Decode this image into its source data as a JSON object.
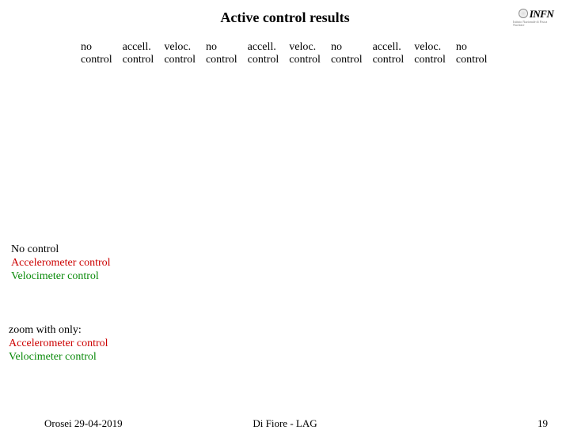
{
  "title": "Active control results",
  "logo": {
    "name": "INFN",
    "sub": "Istituto Nazionale di Fisica Nucleare"
  },
  "columns": [
    {
      "line1": "no",
      "line2": "control"
    },
    {
      "line1": "accell.",
      "line2": "control"
    },
    {
      "line1": "veloc.",
      "line2": "control"
    },
    {
      "line1": "no",
      "line2": "control"
    },
    {
      "line1": "accell.",
      "line2": "control"
    },
    {
      "line1": "veloc.",
      "line2": "control"
    },
    {
      "line1": "no",
      "line2": "control"
    },
    {
      "line1": "accell.",
      "line2": "control"
    },
    {
      "line1": "veloc.",
      "line2": "control"
    },
    {
      "line1": "no",
      "line2": "control"
    }
  ],
  "legend1": {
    "no": "No control",
    "acc": "Accelerometer control",
    "vel": "Velocimeter control"
  },
  "legend2": {
    "intro": "zoom with only:",
    "acc": "Accelerometer control",
    "vel": "Velocimeter control"
  },
  "footer": {
    "left": "Orosei 29-04-2019",
    "center": "Di Fiore - LAG",
    "right": "19"
  }
}
